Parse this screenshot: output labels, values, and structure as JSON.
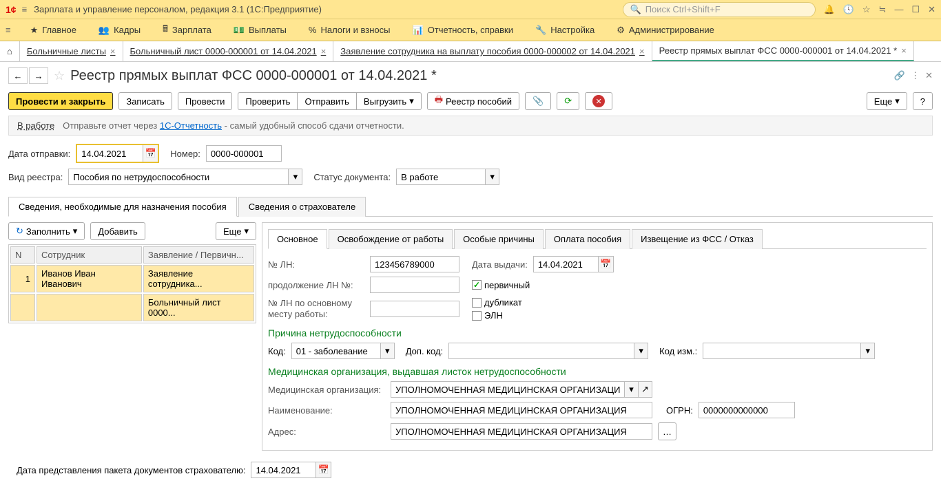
{
  "app": {
    "title": "Зарплата и управление персоналом, редакция 3.1  (1С:Предприятие)",
    "search_placeholder": "Поиск Ctrl+Shift+F"
  },
  "main_menu": [
    "Главное",
    "Кадры",
    "Зарплата",
    "Выплаты",
    "Налоги и взносы",
    "Отчетность, справки",
    "Настройка",
    "Администрирование"
  ],
  "tabs": [
    "Больничные листы",
    "Больничный лист 0000-000001 от 14.04.2021",
    "Заявление сотрудника на выплату пособия 0000-000002 от 14.04.2021",
    "Реестр прямых выплат ФСС 0000-000001 от 14.04.2021 *"
  ],
  "page": {
    "title": "Реестр прямых выплат ФСС 0000-000001 от 14.04.2021 *"
  },
  "toolbar": {
    "post_close": "Провести и закрыть",
    "write": "Записать",
    "post": "Провести",
    "check": "Проверить",
    "send": "Отправить",
    "export": "Выгрузить",
    "registry": "Реестр пособий",
    "more": "Еще"
  },
  "status": {
    "state": "В работе",
    "hint_pre": "Отправьте отчет через ",
    "hint_link": "1С-Отчетность",
    "hint_post": " - самый удобный способ сдачи отчетности."
  },
  "header_fields": {
    "date_label": "Дата отправки:",
    "date_value": "14.04.2021",
    "number_label": "Номер:",
    "number_value": "0000-000001",
    "registry_type_label": "Вид реестра:",
    "registry_type_value": "Пособия по нетрудоспособности",
    "doc_status_label": "Статус документа:",
    "doc_status_value": "В работе"
  },
  "sub_tabs": [
    "Сведения, необходимые для назначения пособия",
    "Сведения о страхователе"
  ],
  "left": {
    "fill": "Заполнить",
    "add": "Добавить",
    "more": "Еще",
    "columns": [
      "N",
      "Сотрудник",
      "Заявление / Первичн..."
    ],
    "rows": [
      {
        "n": "1",
        "employee": "Иванов Иван Иванович",
        "doc": "Заявление сотрудника..."
      },
      {
        "n": "",
        "employee": "",
        "doc": "Больничный лист 0000..."
      }
    ]
  },
  "detail_tabs": [
    "Основное",
    "Освобождение от работы",
    "Особые причины",
    "Оплата пособия",
    "Извещение из ФСС / Отказ"
  ],
  "detail": {
    "ln_no_label": "№ ЛН:",
    "ln_no_value": "123456789000",
    "issue_date_label": "Дата выдачи:",
    "issue_date_value": "14.04.2021",
    "continuation_label": "продолжение ЛН №:",
    "primary_label": "первичный",
    "duplicate_label": "дубликат",
    "eln_label": "ЭЛН",
    "main_workplace_label": "№ ЛН по основному месту работы:",
    "reason_title": "Причина нетрудоспособности",
    "code_label": "Код:",
    "code_value": "01 - заболевание",
    "add_code_label": "Доп. код:",
    "change_code_label": "Код изм.:",
    "med_org_title": "Медицинская организация, выдавшая листок нетрудоспособности",
    "med_org_label": "Медицинская организация:",
    "med_org_value": "УПОЛНОМОЧЕННАЯ МЕДИЦИНСКАЯ ОРГАНИЗАЦИЯ",
    "name_label": "Наименование:",
    "name_value": "УПОЛНОМОЧЕННАЯ МЕДИЦИНСКАЯ ОРГАНИЗАЦИЯ",
    "ogrn_label": "ОГРН:",
    "ogrn_value": "0000000000000",
    "address_label": "Адрес:",
    "address_value": "УПОЛНОМОЧЕННАЯ МЕДИЦИНСКАЯ ОРГАНИЗАЦИЯ"
  },
  "footer": {
    "docs_date_label": "Дата представления пакета документов страхователю:",
    "docs_date_value": "14.04.2021"
  }
}
